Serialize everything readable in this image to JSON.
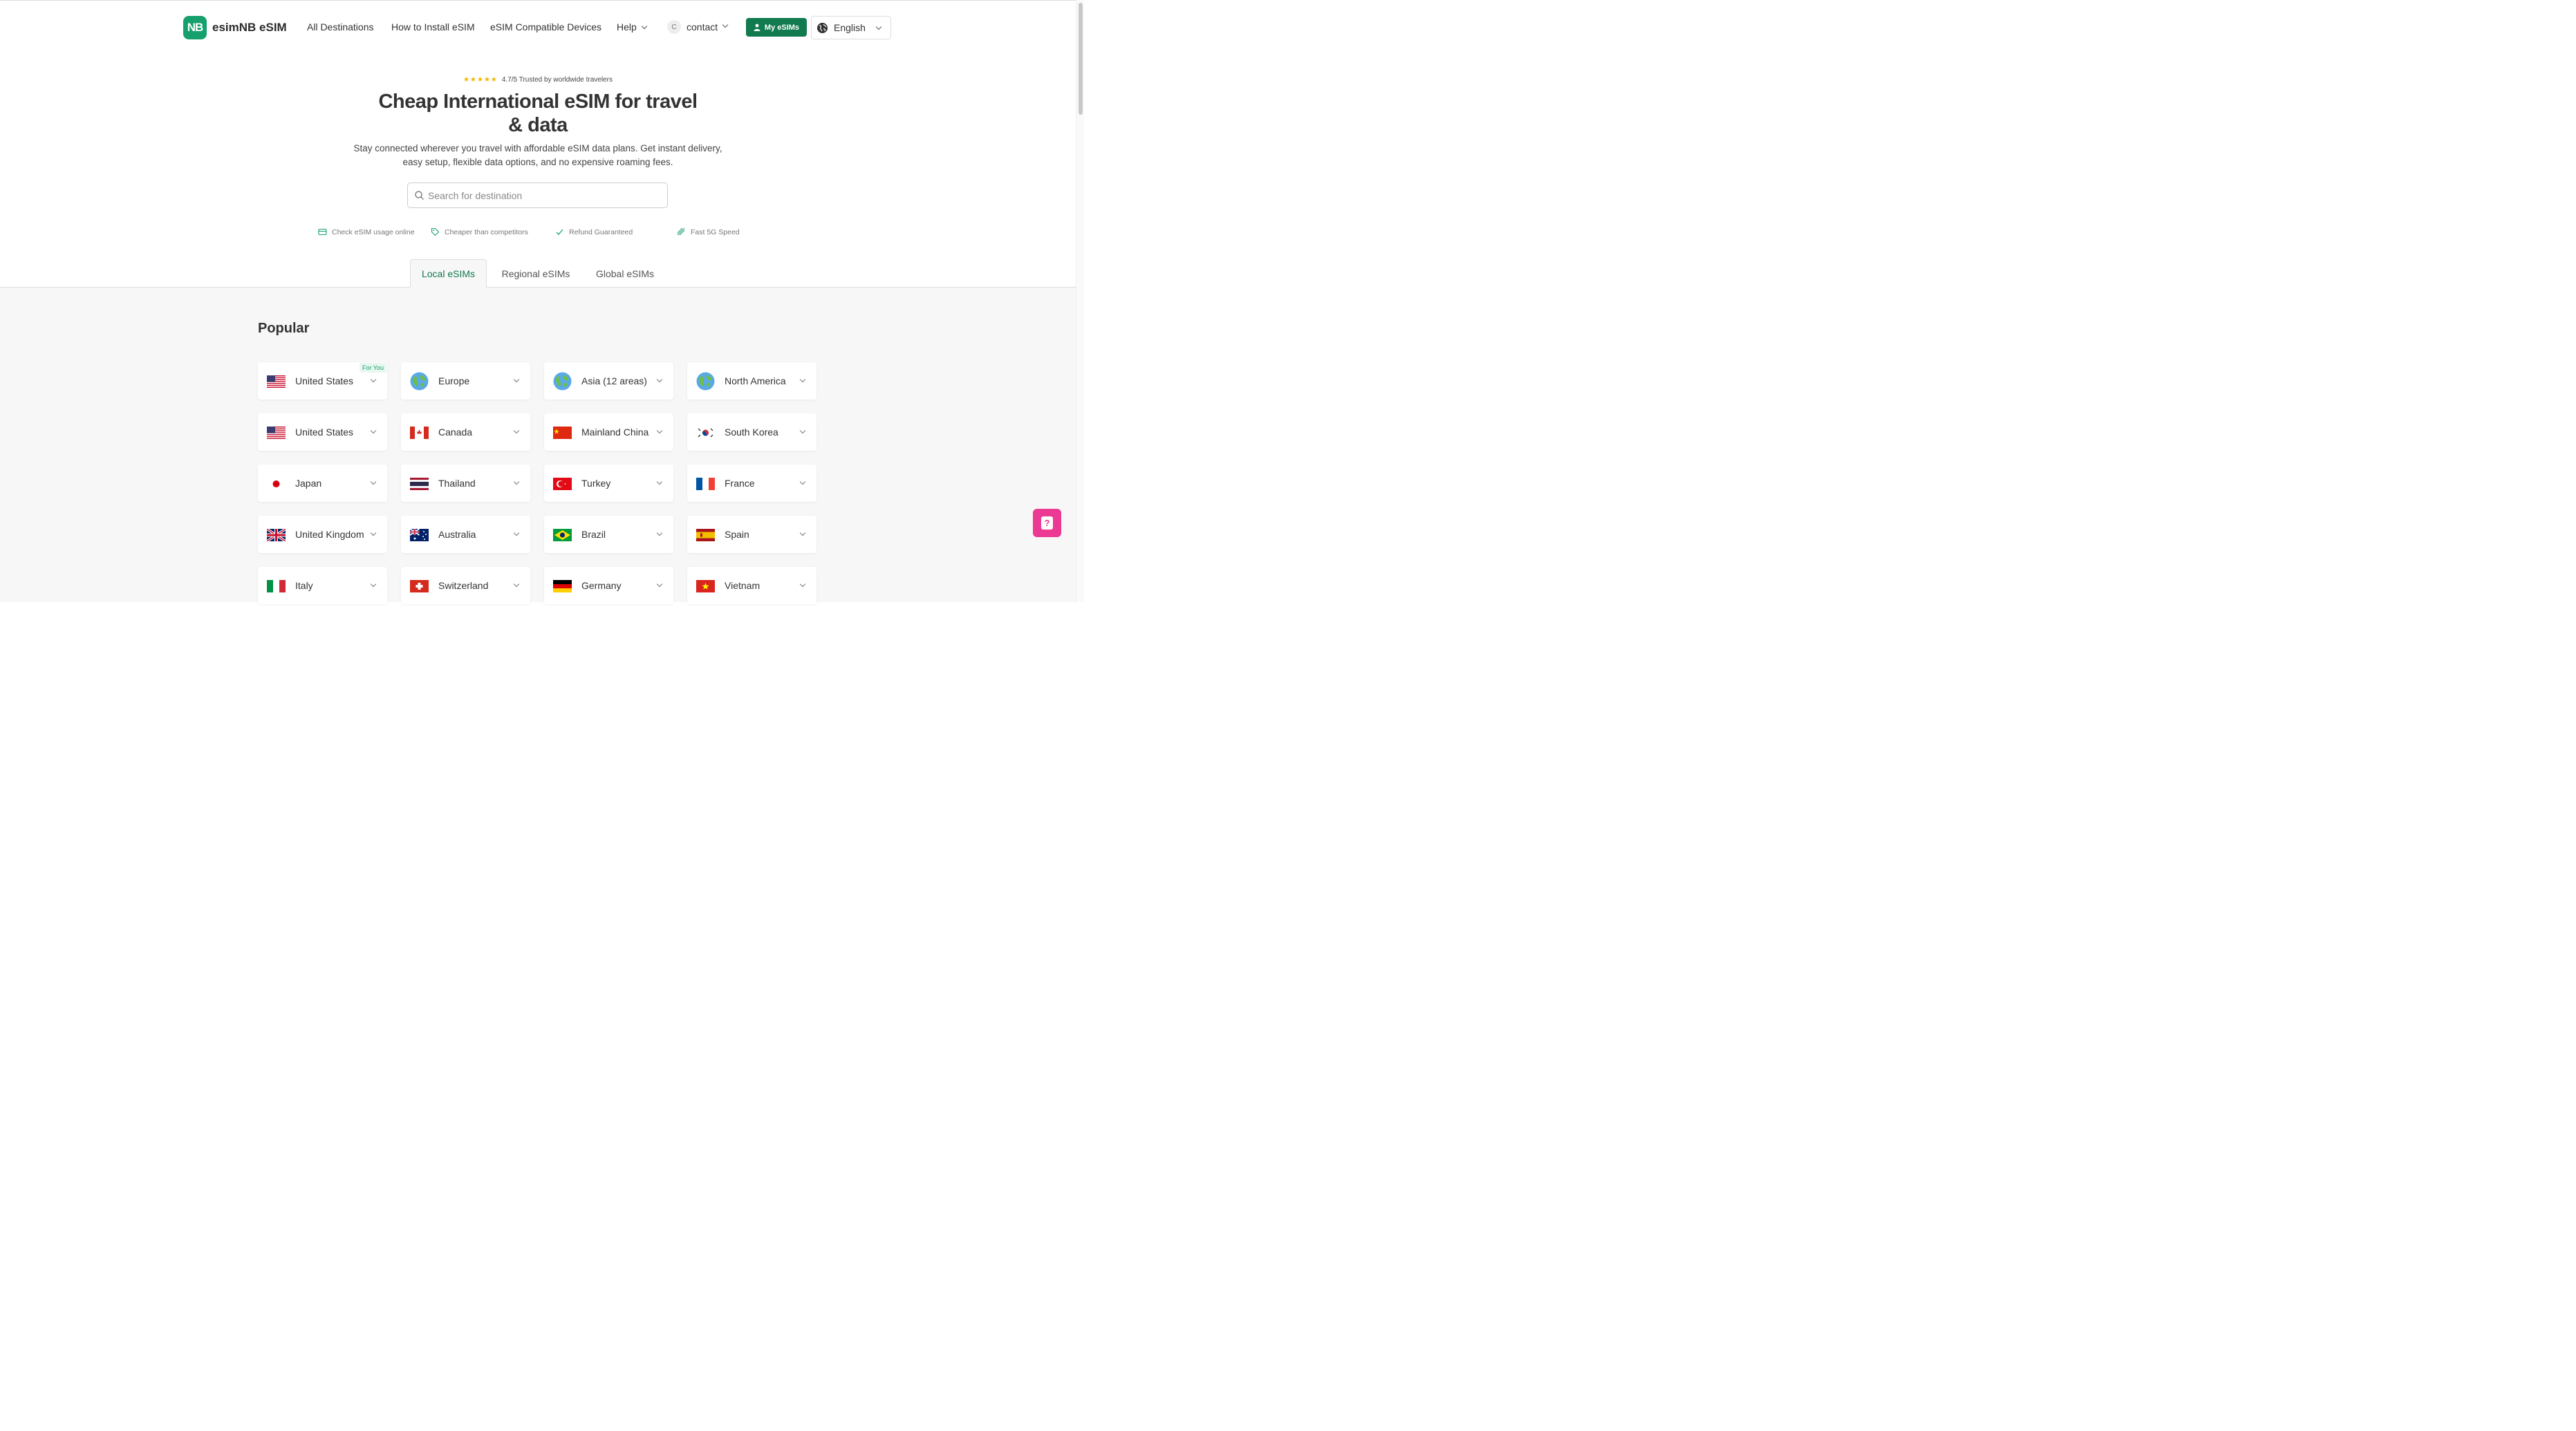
{
  "header": {
    "logo_mark": "NB",
    "logo_text": "esimNB eSIM",
    "nav": [
      "All Destinations",
      "How to Install eSIM",
      "eSIM Compatible Devices",
      "Help"
    ],
    "contact_avatar": "C",
    "contact_label": "contact",
    "my_esims_label": "My eSIMs",
    "language": "English"
  },
  "hero": {
    "stars": "★★★★★",
    "rating_text": "4.7/5 Trusted by worldwide travelers",
    "title_line1": "Cheap International eSIM for travel",
    "title_line2": "& data",
    "subtitle_line1": "Stay connected wherever you travel with affordable eSIM data plans. Get instant delivery,",
    "subtitle_line2": "easy setup, flexible data options, and no expensive roaming fees.",
    "search_placeholder": "Search for destination"
  },
  "features": [
    "Check eSIM usage online",
    "Cheaper than competitors",
    "Refund Guaranteed",
    "Fast 5G Speed"
  ],
  "tabs": [
    "Local eSIMs",
    "Regional eSIMs",
    "Global eSIMs"
  ],
  "active_tab": "Local eSIMs",
  "popular": {
    "title": "Popular",
    "badge": "For You",
    "items": [
      {
        "name": "United States",
        "flag": "us"
      },
      {
        "name": "Europe",
        "flag": "globe"
      },
      {
        "name": "Asia (12 areas)",
        "flag": "globe"
      },
      {
        "name": "North America",
        "flag": "globe"
      },
      {
        "name": "United States",
        "flag": "us"
      },
      {
        "name": "Canada",
        "flag": "ca"
      },
      {
        "name": "Mainland China",
        "flag": "cn"
      },
      {
        "name": "South Korea",
        "flag": "kr"
      },
      {
        "name": "Japan",
        "flag": "jp"
      },
      {
        "name": "Thailand",
        "flag": "th"
      },
      {
        "name": "Turkey",
        "flag": "tr"
      },
      {
        "name": "France",
        "flag": "fr"
      },
      {
        "name": "United Kingdom",
        "flag": "gb"
      },
      {
        "name": "Australia",
        "flag": "au"
      },
      {
        "name": "Brazil",
        "flag": "br"
      },
      {
        "name": "Spain",
        "flag": "es"
      },
      {
        "name": "Italy",
        "flag": "it"
      },
      {
        "name": "Switzerland",
        "flag": "ch"
      },
      {
        "name": "Germany",
        "flag": "de"
      },
      {
        "name": "Vietnam",
        "flag": "vn"
      }
    ]
  },
  "help_button": "?",
  "colors": {
    "brand": "#16a06e",
    "button": "#127a4f",
    "help": "#ec3a94",
    "star": "#f5b400"
  }
}
